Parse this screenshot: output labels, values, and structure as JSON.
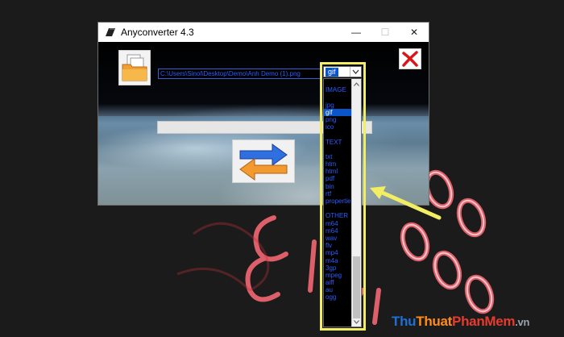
{
  "window": {
    "title": "Anyconverter 4.3",
    "controls": {
      "minimize": "—",
      "maximize": "☐",
      "close": "✕"
    }
  },
  "toolbar": {
    "open_icon": "folder-open-icon",
    "path_value": "C:\\Users\\Sinol\\Desktop\\Demo\\Anh Demo (1).png",
    "exit_icon": "red-x-icon",
    "convert_icon": "swap-arrows-icon"
  },
  "format_select": {
    "selected": "gif",
    "options": [
      "",
      "IMAGE",
      "",
      "jpg",
      "gif",
      "png",
      "ico",
      "",
      "TEXT",
      "",
      "txt",
      "htm",
      "html",
      "pdf",
      "bin",
      "rtf",
      "properties",
      "",
      "OTHER",
      "m64",
      "m64",
      "wav",
      "flv",
      "mp4",
      "m4a",
      "3gp",
      "mpeg",
      "aiff",
      "au",
      "ogg"
    ]
  },
  "scroll": {
    "thumb_fraction": 0.27
  },
  "watermark": {
    "part1": "Thu",
    "part2": "Thuat",
    "part3": "PhanMem",
    "part4": ".vn"
  },
  "colors": {
    "highlight": "#f1ee63",
    "list_text": "#2a5cff",
    "selected_bg": "#0a55c8"
  }
}
